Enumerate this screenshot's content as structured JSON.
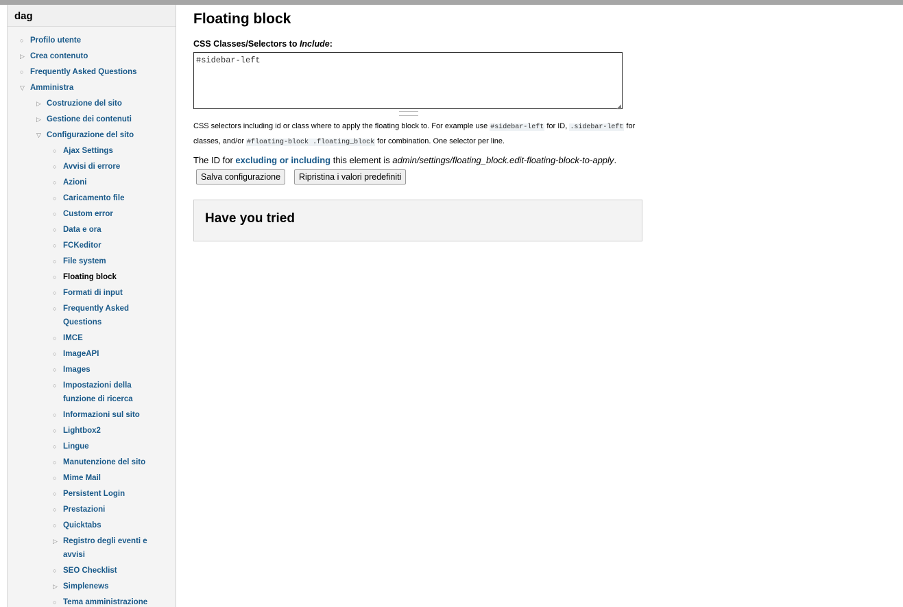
{
  "sidebar": {
    "title": "dag",
    "items": [
      {
        "label": "Profilo utente",
        "bullet": "○",
        "level": 0,
        "active": false
      },
      {
        "label": "Crea contenuto",
        "bullet": "▷",
        "level": 0,
        "active": false
      },
      {
        "label": "Frequently Asked Questions",
        "bullet": "○",
        "level": 0,
        "active": false
      },
      {
        "label": "Amministra",
        "bullet": "▽",
        "level": 0,
        "active": false
      },
      {
        "label": "Costruzione del sito",
        "bullet": "▷",
        "level": 1,
        "active": false
      },
      {
        "label": "Gestione dei contenuti",
        "bullet": "▷",
        "level": 1,
        "active": false
      },
      {
        "label": "Configurazione del sito",
        "bullet": "▽",
        "level": 1,
        "active": false
      },
      {
        "label": "Ajax Settings",
        "bullet": "○",
        "level": 2,
        "active": false
      },
      {
        "label": "Avvisi di errore",
        "bullet": "○",
        "level": 2,
        "active": false
      },
      {
        "label": "Azioni",
        "bullet": "○",
        "level": 2,
        "active": false
      },
      {
        "label": "Caricamento file",
        "bullet": "○",
        "level": 2,
        "active": false
      },
      {
        "label": "Custom error",
        "bullet": "○",
        "level": 2,
        "active": false
      },
      {
        "label": "Data e ora",
        "bullet": "○",
        "level": 2,
        "active": false
      },
      {
        "label": "FCKeditor",
        "bullet": "○",
        "level": 2,
        "active": false
      },
      {
        "label": "File system",
        "bullet": "○",
        "level": 2,
        "active": false
      },
      {
        "label": "Floating block",
        "bullet": "○",
        "level": 2,
        "active": true
      },
      {
        "label": "Formati di input",
        "bullet": "○",
        "level": 2,
        "active": false
      },
      {
        "label": "Frequently Asked Questions",
        "bullet": "○",
        "level": 2,
        "active": false
      },
      {
        "label": "IMCE",
        "bullet": "○",
        "level": 2,
        "active": false
      },
      {
        "label": "ImageAPI",
        "bullet": "○",
        "level": 2,
        "active": false
      },
      {
        "label": "Images",
        "bullet": "○",
        "level": 2,
        "active": false
      },
      {
        "label": "Impostazioni della funzione di ricerca",
        "bullet": "○",
        "level": 2,
        "active": false
      },
      {
        "label": "Informazioni sul sito",
        "bullet": "○",
        "level": 2,
        "active": false
      },
      {
        "label": "Lightbox2",
        "bullet": "○",
        "level": 2,
        "active": false
      },
      {
        "label": "Lingue",
        "bullet": "○",
        "level": 2,
        "active": false
      },
      {
        "label": "Manutenzione del sito",
        "bullet": "○",
        "level": 2,
        "active": false
      },
      {
        "label": "Mime Mail",
        "bullet": "○",
        "level": 2,
        "active": false
      },
      {
        "label": "Persistent Login",
        "bullet": "○",
        "level": 2,
        "active": false
      },
      {
        "label": "Prestazioni",
        "bullet": "○",
        "level": 2,
        "active": false
      },
      {
        "label": "Quicktabs",
        "bullet": "○",
        "level": 2,
        "active": false
      },
      {
        "label": "Registro degli eventi e avvisi",
        "bullet": "▷",
        "level": 2,
        "active": false
      },
      {
        "label": "SEO Checklist",
        "bullet": "○",
        "level": 2,
        "active": false
      },
      {
        "label": "Simplenews",
        "bullet": "▷",
        "level": 2,
        "active": false
      },
      {
        "label": "Tema amministrazione",
        "bullet": "○",
        "level": 2,
        "active": false
      }
    ]
  },
  "main": {
    "title": "Floating block",
    "field_label_prefix": "CSS Classes/Selectors to ",
    "field_label_em": "Include",
    "field_label_suffix": ":",
    "textarea_value": "#sidebar-left",
    "desc": {
      "p1": "CSS selectors including id or class where to apply the floating block to. For example use ",
      "code1": "#sidebar-left",
      "p2": " for ID, ",
      "code2": ".sidebar-left",
      "p3": " for classes, and/or ",
      "code3": "#floating-block .floating_block",
      "p4": " for combination. One selector per line."
    },
    "idline": {
      "prefix": "The ID for ",
      "link": "excluding or including",
      "middle": " this element is ",
      "id": "admin/settings/floating_block.edit-floating-block-to-apply",
      "suffix": "."
    },
    "save_label": "Salva configurazione",
    "reset_label": "Ripristina i valori predefiniti",
    "box_title": "Have you tried"
  }
}
